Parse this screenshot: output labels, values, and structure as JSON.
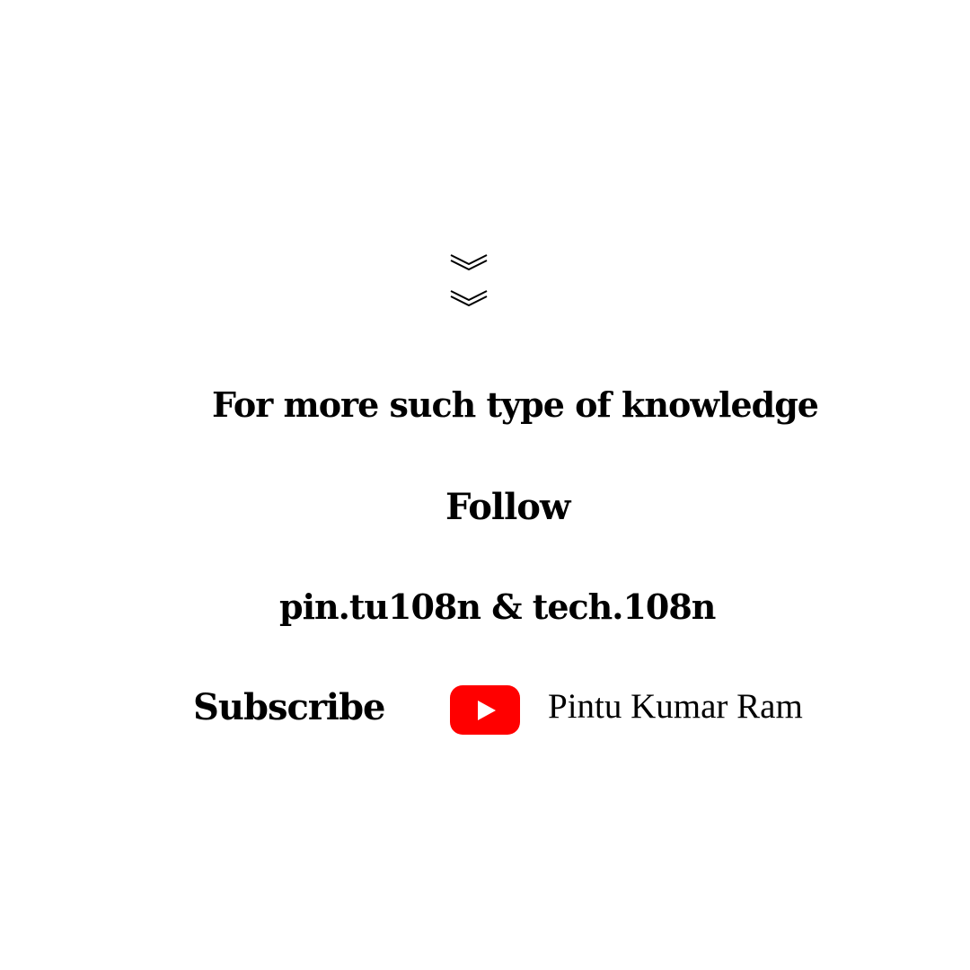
{
  "icons": {
    "scroll_down": "double-chevron-down",
    "youtube": "youtube-logo"
  },
  "colors": {
    "background": "#ffffff",
    "text": "#000000",
    "youtube_red": "#ff0000",
    "youtube_play": "#ffffff"
  },
  "text": {
    "tagline": "For more such type of  knowledge",
    "follow": "Follow",
    "handles": "pin.tu108n & tech.108n",
    "subscribe": "Subscribe",
    "channel_name": "Pintu Kumar Ram"
  }
}
